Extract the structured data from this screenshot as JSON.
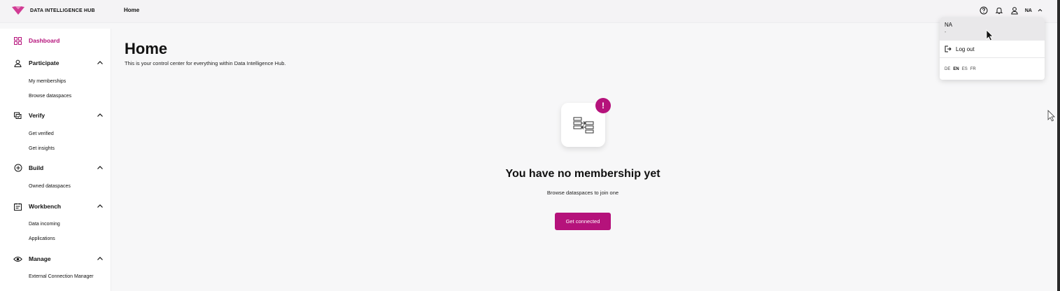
{
  "brand": {
    "name": "DATA INTELLIGENCE HUB",
    "accent": "#b5127b"
  },
  "header": {
    "breadcrumb": "Home",
    "icons": [
      "help-icon",
      "bell-icon",
      "user-icon"
    ],
    "user_initials": "NA"
  },
  "sidebar": {
    "dashboard": "Dashboard",
    "sections": [
      {
        "label": "Participate",
        "icon": "person-icon",
        "items": [
          "My memberships",
          "Browse dataspaces"
        ]
      },
      {
        "label": "Verify",
        "icon": "verify-icon",
        "items": [
          "Get verified",
          "Get insights"
        ]
      },
      {
        "label": "Build",
        "icon": "plus-circle-icon",
        "items": [
          "Owned dataspaces"
        ]
      },
      {
        "label": "Workbench",
        "icon": "workbench-icon",
        "items": [
          "Data incoming",
          "Applications"
        ]
      },
      {
        "label": "Manage",
        "icon": "eye-icon",
        "items": [
          "External Connection Manager"
        ]
      }
    ]
  },
  "main": {
    "title": "Home",
    "subtitle": "This is your control center for everything within Data Intelligence Hub.",
    "empty": {
      "badge": "!",
      "title": "You have no membership yet",
      "subtitle": "Browse dataspaces to join one",
      "cta": "Get connected"
    }
  },
  "user_menu": {
    "name": "NA",
    "secondary": "-",
    "logout": "Log out",
    "languages": [
      "DE",
      "EN",
      "ES",
      "FR"
    ],
    "active_language": "EN"
  }
}
